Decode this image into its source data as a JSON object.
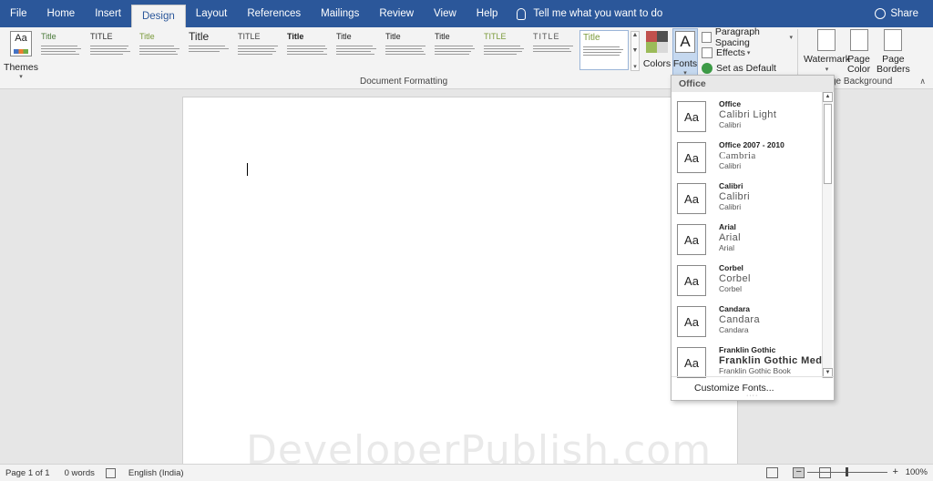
{
  "menubar": {
    "tabs": [
      "File",
      "Home",
      "Insert",
      "Design",
      "Layout",
      "References",
      "Mailings",
      "Review",
      "View",
      "Help"
    ],
    "active_tab": "Design",
    "tell_me": "Tell me what you want to do",
    "share": "Share"
  },
  "ribbon": {
    "themes_label": "Themes",
    "style_gallery": [
      {
        "title": "Title"
      },
      {
        "title": "TITLE"
      },
      {
        "title": "Title"
      },
      {
        "title": "Title"
      },
      {
        "title": "TITLE"
      },
      {
        "title": "Title"
      },
      {
        "title": "Title"
      },
      {
        "title": "Title"
      },
      {
        "title": "Title"
      },
      {
        "title": "TITLE"
      },
      {
        "title": "TITLE"
      },
      {
        "title": "Title"
      }
    ],
    "colors_label": "Colors",
    "fonts_label": "Fonts",
    "paragraph_spacing": "Paragraph Spacing",
    "effects": "Effects",
    "set_as_default": "Set as Default",
    "document_formatting_group": "Document Formatting",
    "watermark": "Watermark",
    "page_color_1": "Page",
    "page_color_2": "Color",
    "page_borders_1": "Page",
    "page_borders_2": "Borders",
    "page_background_group": "ge Background"
  },
  "theme_colors": [
    "#c0504d",
    "#4f4f4f",
    "#9bbb59",
    "#d9d9d9"
  ],
  "fonts_dropdown": {
    "header": "Office",
    "items": [
      {
        "name": "Office",
        "heading": "Calibri Light",
        "body": "Calibri"
      },
      {
        "name": "Office 2007 - 2010",
        "heading": "Cambria",
        "body": "Calibri"
      },
      {
        "name": "Calibri",
        "heading": "Calibri",
        "body": "Calibri"
      },
      {
        "name": "Arial",
        "heading": "Arial",
        "body": "Arial"
      },
      {
        "name": "Corbel",
        "heading": "Corbel",
        "body": "Corbel"
      },
      {
        "name": "Candara",
        "heading": "Candara",
        "body": "Candara"
      },
      {
        "name": "Franklin Gothic",
        "heading": "Franklin Gothic Med",
        "body": "Franklin Gothic Book"
      }
    ],
    "aa_label": "Aa",
    "customize": "Customize Fonts..."
  },
  "watermark_text": "DeveloperPublish.com",
  "statusbar": {
    "page": "Page 1 of 1",
    "words": "0 words",
    "language": "English (India)",
    "zoom": "100%"
  }
}
